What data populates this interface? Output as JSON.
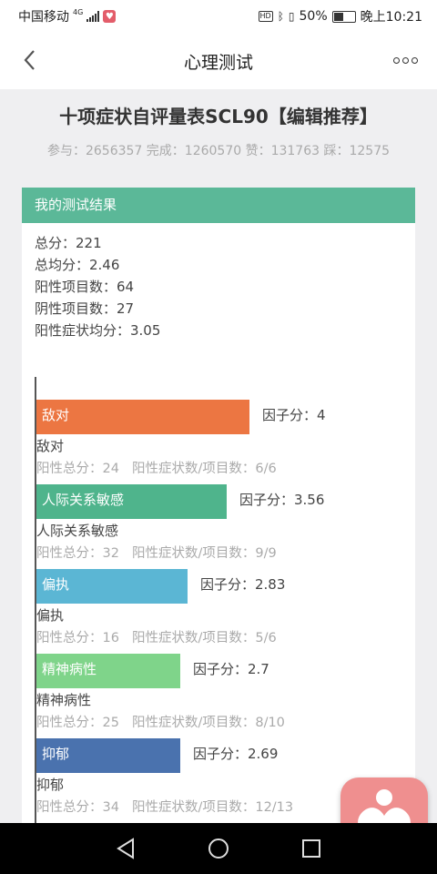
{
  "status_bar": {
    "carrier": "中国移动",
    "network": "4G",
    "battery_percent": "50%",
    "time": "晚上10:21"
  },
  "nav": {
    "title": "心理测试"
  },
  "test": {
    "title": "十项症状自评量表SCL90【编辑推荐】",
    "stats": "参与：2656357 完成：1260570 赞：131763 踩：12575"
  },
  "result": {
    "header": "我的测试结果",
    "summary": [
      "总分：221",
      "总均分：2.46",
      "阳性项目数：64",
      "阴性项目数：27",
      "阳性症状均分：3.05"
    ]
  },
  "chart_data": {
    "type": "bar",
    "orientation": "horizontal",
    "categories": [
      "敌对",
      "人际关系敏感",
      "偏执",
      "精神病性",
      "抑郁"
    ],
    "values": [
      4,
      3.56,
      2.83,
      2.7,
      2.69
    ],
    "colors": [
      "#ec7642",
      "#4fb48c",
      "#5bb6d4",
      "#7fd48a",
      "#4a72ae"
    ],
    "factor_labels": [
      "因子分：4",
      "因子分：3.56",
      "因子分：2.83",
      "因子分：2.7",
      "因子分：2.69"
    ],
    "positive_totals": [
      "阳性总分：24",
      "阳性总分：32",
      "阳性总分：16",
      "阳性总分：25",
      "阳性总分：34"
    ],
    "positive_counts": [
      "阳性症状数/项目数：6/6",
      "阳性症状数/项目数：9/9",
      "阳性症状数/项目数：5/6",
      "阳性症状数/项目数：8/10",
      "阳性症状数/项目数：12/13"
    ],
    "xlim": [
      0,
      5
    ]
  }
}
